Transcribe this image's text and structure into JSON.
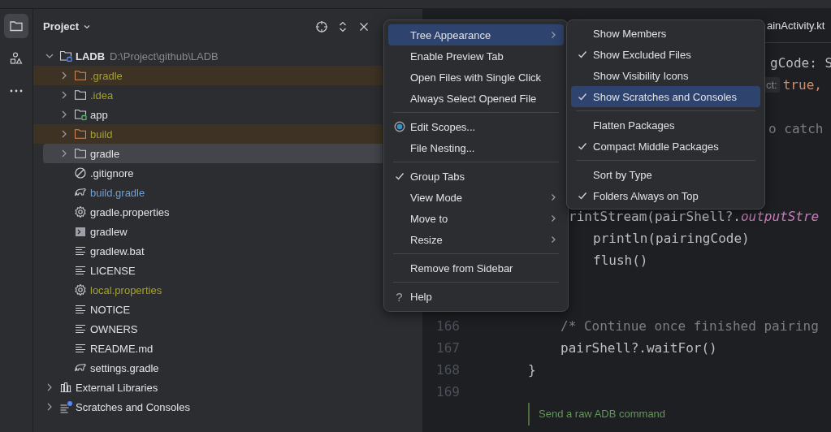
{
  "tool_stripe": [
    {
      "kind": "project",
      "selected": true
    },
    {
      "kind": "structure",
      "selected": false
    },
    {
      "kind": "more",
      "selected": false
    }
  ],
  "project_panel": {
    "title": "Project",
    "tree": [
      {
        "label": "LADB",
        "path": "D:\\Project\\github\\LADB",
        "kind": "module-root",
        "expanded": true,
        "selected": false,
        "excluded": false,
        "ignored": false,
        "modified": false,
        "children": [
          {
            "label": ".gradle",
            "kind": "folder",
            "expanded": false,
            "selected": false,
            "excluded": true,
            "ignored": true,
            "modified": false
          },
          {
            "label": ".idea",
            "kind": "folder",
            "expanded": false,
            "selected": false,
            "excluded": false,
            "ignored": true,
            "modified": false
          },
          {
            "label": "app",
            "kind": "module",
            "expanded": false,
            "selected": false,
            "excluded": false,
            "ignored": false,
            "modified": false
          },
          {
            "label": "build",
            "kind": "folder",
            "expanded": false,
            "selected": false,
            "excluded": true,
            "ignored": true,
            "modified": false
          },
          {
            "label": "gradle",
            "kind": "folder",
            "expanded": false,
            "selected": true,
            "excluded": false,
            "ignored": false,
            "modified": false
          },
          {
            "label": ".gitignore",
            "kind": "ignore",
            "selected": false,
            "excluded": false,
            "ignored": false,
            "modified": false
          },
          {
            "label": "build.gradle",
            "kind": "gradle",
            "selected": false,
            "excluded": false,
            "ignored": false,
            "modified": true
          },
          {
            "label": "gradle.properties",
            "kind": "gear",
            "selected": false,
            "excluded": false,
            "ignored": false,
            "modified": false
          },
          {
            "label": "gradlew",
            "kind": "terminal",
            "selected": false,
            "excluded": false,
            "ignored": false,
            "modified": false
          },
          {
            "label": "gradlew.bat",
            "kind": "text",
            "selected": false,
            "excluded": false,
            "ignored": false,
            "modified": false
          },
          {
            "label": "LICENSE",
            "kind": "text",
            "selected": false,
            "excluded": false,
            "ignored": false,
            "modified": false
          },
          {
            "label": "local.properties",
            "kind": "gear",
            "selected": false,
            "excluded": false,
            "ignored": true,
            "modified": false
          },
          {
            "label": "NOTICE",
            "kind": "text",
            "selected": false,
            "excluded": false,
            "ignored": false,
            "modified": false
          },
          {
            "label": "OWNERS",
            "kind": "text",
            "selected": false,
            "excluded": false,
            "ignored": false,
            "modified": false
          },
          {
            "label": "README.md",
            "kind": "text",
            "selected": false,
            "excluded": false,
            "ignored": false,
            "modified": false
          },
          {
            "label": "settings.gradle",
            "kind": "gradle",
            "selected": false,
            "excluded": false,
            "ignored": false,
            "modified": false
          }
        ]
      },
      {
        "label": "External Libraries",
        "kind": "libraries",
        "expanded": false,
        "selected": false,
        "excluded": false,
        "ignored": false,
        "modified": false
      },
      {
        "label": "Scratches and Consoles",
        "kind": "scratches",
        "expanded": false,
        "selected": false,
        "excluded": false,
        "ignored": false,
        "modified": false
      }
    ]
  },
  "editor": {
    "tab": {
      "label": "ainActivity.kt"
    },
    "lines": [
      {
        "segments": [
          {
            "kind": "code",
            "text": "gCode: S"
          }
        ]
      },
      {
        "segments": [
          {
            "kind": "hint",
            "text": "ct:"
          },
          {
            "kind": "keyword",
            "text": "true,"
          }
        ]
      },
      {
        "segments": [
          {
            "kind": "comment",
            "text": "o catch"
          }
        ]
      },
      {
        "segments": [
          {
            "kind": "code",
            "text": "rintStream(pairShell?."
          },
          {
            "kind": "property",
            "text": "outputStre"
          }
        ]
      },
      {
        "segments": [
          {
            "kind": "code",
            "text": "println(pairingCode)"
          }
        ]
      },
      {
        "segments": [
          {
            "kind": "code",
            "text": "flush()"
          }
        ]
      },
      {
        "number": "166",
        "segments": [
          {
            "kind": "comment",
            "text": "/* Continue once finished pairing"
          }
        ]
      },
      {
        "number": "167",
        "segments": [
          {
            "kind": "code",
            "text": "pairShell?.waitFor()"
          }
        ]
      },
      {
        "number": "168",
        "segments": [
          {
            "kind": "code",
            "text": "}"
          }
        ]
      },
      {
        "number": "169"
      }
    ],
    "inlay": {
      "text": "Send a raw ADB command"
    }
  },
  "context_menu": {
    "groups": [
      [
        {
          "kind": "plain",
          "label": "Tree Appearance",
          "checked": false,
          "submenu": true,
          "selected": true
        },
        {
          "kind": "plain",
          "label": "Enable Preview Tab",
          "checked": false,
          "submenu": false,
          "selected": false
        },
        {
          "kind": "plain",
          "label": "Open Files with Single Click",
          "checked": false,
          "submenu": false,
          "selected": false
        },
        {
          "kind": "plain",
          "label": "Always Select Opened File",
          "checked": false,
          "submenu": false,
          "selected": false
        }
      ],
      [
        {
          "kind": "radio",
          "label": "Edit Scopes...",
          "checked": false,
          "submenu": false,
          "selected": false
        },
        {
          "kind": "plain",
          "label": "File Nesting...",
          "checked": false,
          "submenu": false,
          "selected": false
        }
      ],
      [
        {
          "kind": "plain",
          "label": "Group Tabs",
          "checked": true,
          "submenu": false,
          "selected": false
        },
        {
          "kind": "plain",
          "label": "View Mode",
          "checked": false,
          "submenu": true,
          "selected": false
        },
        {
          "kind": "plain",
          "label": "Move to",
          "checked": false,
          "submenu": true,
          "selected": false
        },
        {
          "kind": "plain",
          "label": "Resize",
          "checked": false,
          "submenu": true,
          "selected": false
        }
      ],
      [
        {
          "kind": "plain",
          "label": "Remove from Sidebar",
          "checked": false,
          "submenu": false,
          "selected": false
        }
      ],
      [
        {
          "kind": "help",
          "icon": "?",
          "label": "Help",
          "checked": false,
          "submenu": false,
          "selected": false
        }
      ]
    ]
  },
  "submenu": {
    "groups": [
      [
        {
          "label": "Show Members",
          "checked": false,
          "selected": false
        },
        {
          "label": "Show Excluded Files",
          "checked": true,
          "selected": false
        },
        {
          "label": "Show Visibility Icons",
          "checked": false,
          "selected": false
        },
        {
          "label": "Show Scratches and Consoles",
          "checked": true,
          "selected": true
        }
      ],
      [
        {
          "label": "Flatten Packages",
          "checked": false,
          "selected": false
        },
        {
          "label": "Compact Middle Packages",
          "checked": true,
          "selected": false
        }
      ],
      [
        {
          "label": "Sort by Type",
          "checked": false,
          "selected": false
        },
        {
          "label": "Folders Always on Top",
          "checked": true,
          "selected": false
        }
      ]
    ]
  }
}
